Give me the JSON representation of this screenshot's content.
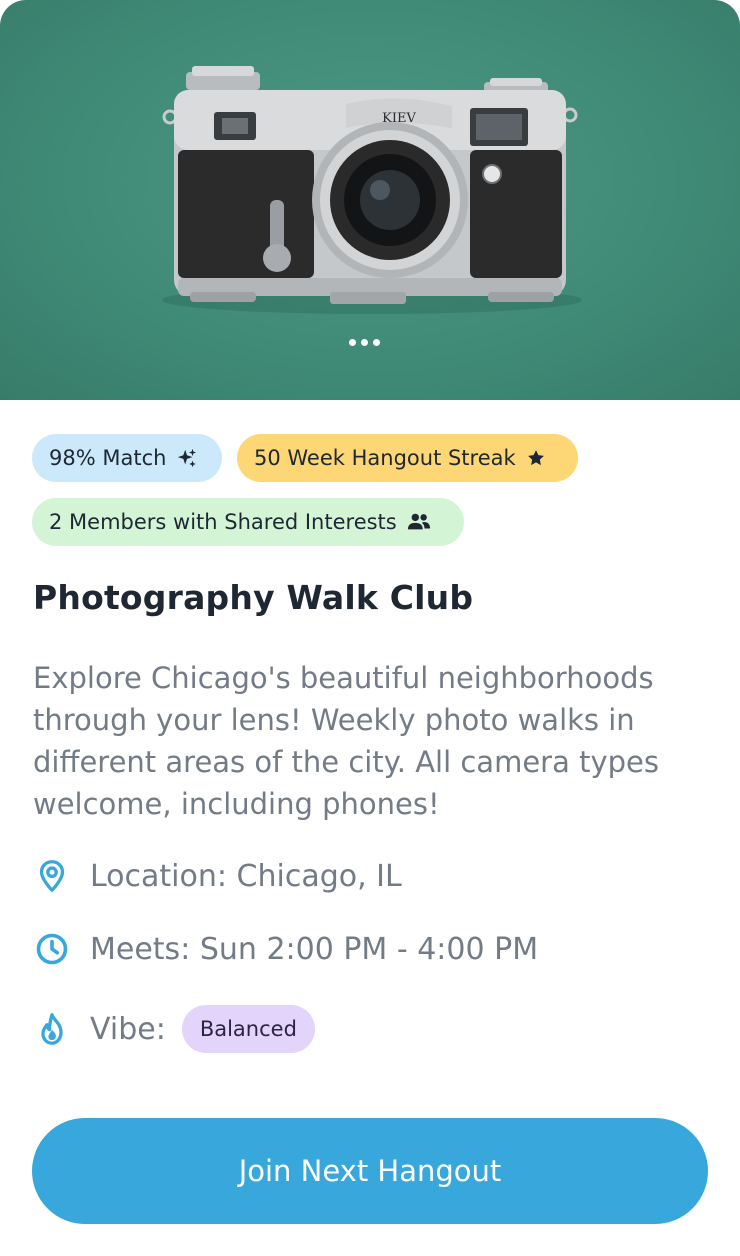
{
  "hero": {
    "image": "vintage-rangefinder-camera-photo",
    "camera_brand": "KIEV",
    "carousel_dots": 3
  },
  "tags": {
    "match": {
      "label": "98% Match",
      "icon": "sparkles-icon"
    },
    "streak": {
      "label": "50 Week Hangout Streak",
      "icon": "star-icon"
    },
    "members": {
      "label": "2 Members with Shared Interests",
      "icon": "people-icon"
    }
  },
  "title": "Photography Walk Club",
  "description": "Explore Chicago's beautiful neighborhoods through your lens! Weekly photo walks in different areas of the city. All camera types welcome, including phones!",
  "details": {
    "location": "Location: Chicago, IL",
    "meets": "Meets: Sun 2:00 PM - 4:00 PM",
    "vibe_label": "Vibe:",
    "vibe_value": "Balanced"
  },
  "cta": {
    "label": "Join Next Hangout"
  },
  "colors": {
    "hero_bg": "#418C78",
    "match_tag": "#CBE9FB",
    "streak_tag": "#FDD775",
    "members_tag": "#D3F5D5",
    "vibe_badge": "#E3D4FB",
    "accent": "#37A7DC",
    "title_text": "#1F2733",
    "body_text": "#737B86"
  }
}
